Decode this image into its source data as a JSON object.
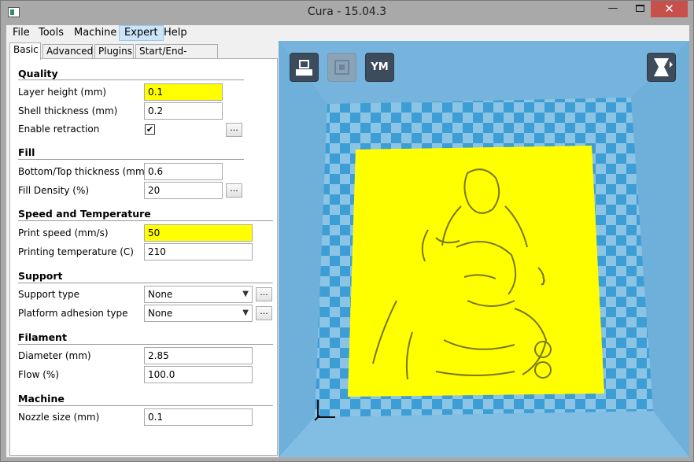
{
  "window": {
    "title": "Cura - 15.04.3",
    "minimize_glyph": "—",
    "close_glyph": "✕"
  },
  "menu": [
    {
      "label": "File"
    },
    {
      "label": "Tools"
    },
    {
      "label": "Machine"
    },
    {
      "label": "Expert"
    },
    {
      "label": "Help"
    }
  ],
  "tabs": [
    "Basic",
    "Advanced",
    "Plugins",
    "Start/End-GCode"
  ],
  "quality": {
    "title": "Quality",
    "layer_height_label": "Layer height (mm)",
    "layer_height_value": "0.1",
    "shell_thickness_label": "Shell thickness (mm)",
    "shell_thickness_value": "0.2",
    "enable_retraction_label": "Enable retraction",
    "enable_retraction_checked": true
  },
  "fill": {
    "title": "Fill",
    "bottom_top_label": "Bottom/Top thickness (mm)",
    "bottom_top_value": "0.6",
    "fill_density_label": "Fill Density (%)",
    "fill_density_value": "20"
  },
  "speed": {
    "title": "Speed and Temperature",
    "print_speed_label": "Print speed (mm/s)",
    "print_speed_value": "50",
    "printing_temp_label": "Printing temperature (C)",
    "printing_temp_value": "210"
  },
  "support": {
    "title": "Support",
    "support_type_label": "Support type",
    "support_type_value": "None",
    "adhesion_label": "Platform adhesion type",
    "adhesion_value": "None"
  },
  "filament": {
    "title": "Filament",
    "diameter_label": "Diameter (mm)",
    "diameter_value": "2.85",
    "flow_label": "Flow (%)",
    "flow_value": "100.0"
  },
  "machine": {
    "title": "Machine",
    "nozzle_label": "Nozzle size (mm)",
    "nozzle_value": "0.1"
  },
  "buttons": {
    "dots_label": "...",
    "ym_label": "YM"
  },
  "colors": {
    "warning_field": "#ffff00",
    "build_plate_dark": "#3d9ed6",
    "build_plate_light": "#8cc4e6",
    "model": "#ffff00",
    "close_button": "#c7504b"
  },
  "icons": {
    "load": "load-model-icon",
    "save": "save-gcode-icon",
    "ym": "youmagine-icon",
    "view_mode": "view-mode-icon",
    "dropdown": "chevron-down-icon",
    "axes": "axis-origin-icon"
  }
}
